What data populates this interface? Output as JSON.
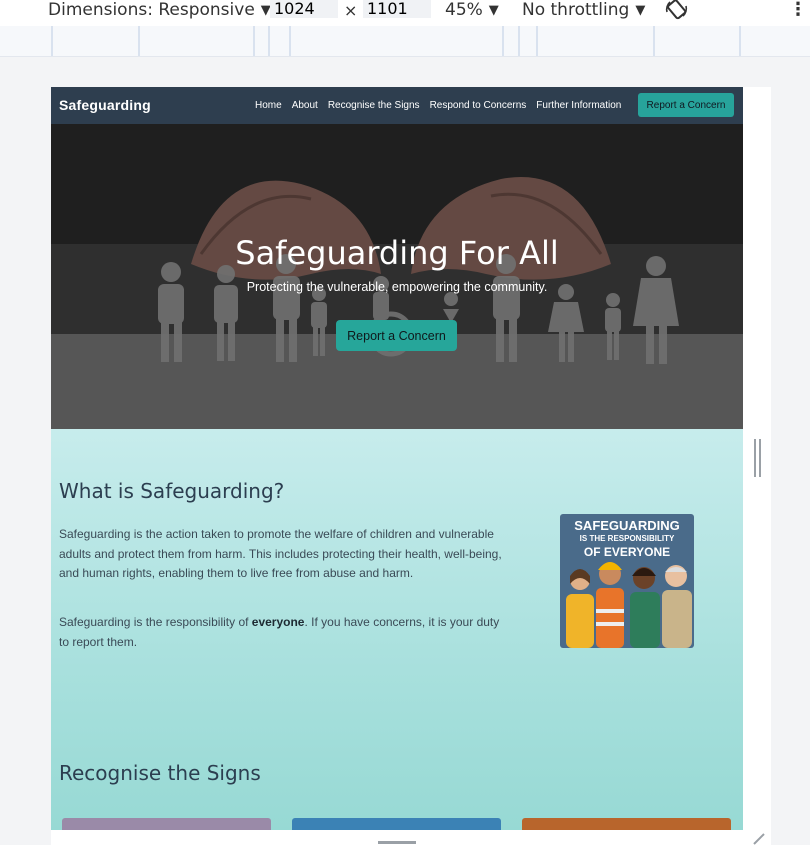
{
  "devtools": {
    "dimensions_label": "Dimensions: Responsive",
    "width": "1024",
    "times": "×",
    "height": "1101",
    "zoom": "45%",
    "throttling": "No throttling",
    "rotate_icon": "rotate-icon",
    "more_icon": "⋮"
  },
  "site": {
    "brand": "Safeguarding",
    "nav": [
      "Home",
      "About",
      "Recognise the Signs",
      "Respond to Concerns",
      "Further Information"
    ],
    "nav_button": "Report a Concern",
    "hero": {
      "title": "Safeguarding For All",
      "subtitle": "Protecting the vulnerable, empowering the community.",
      "button": "Report a Concern"
    },
    "about": {
      "heading": "What is Safeguarding?",
      "para1": "Safeguarding is the action taken to promote the welfare of children and vulnerable adults and protect them from harm. This includes protecting their health, well-being, and human rights, enabling them to live free from abuse and harm.",
      "para2_before": "Safeguarding is the responsibility of ",
      "para2_bold": "everyone",
      "para2_after": ". If you have concerns, it is your duty to report them.",
      "poster": {
        "line1": "SAFEGUARDING",
        "line2": "IS THE RESPONSIBILITY",
        "line3": "OF EVERYONE"
      }
    },
    "signs_heading": "Recognise the Signs"
  },
  "colors": {
    "nav_bg": "#2e3e4f",
    "accent": "#26a69a",
    "card1": "#9a8aa8",
    "card2": "#3b82b5",
    "card3": "#b8652c"
  }
}
